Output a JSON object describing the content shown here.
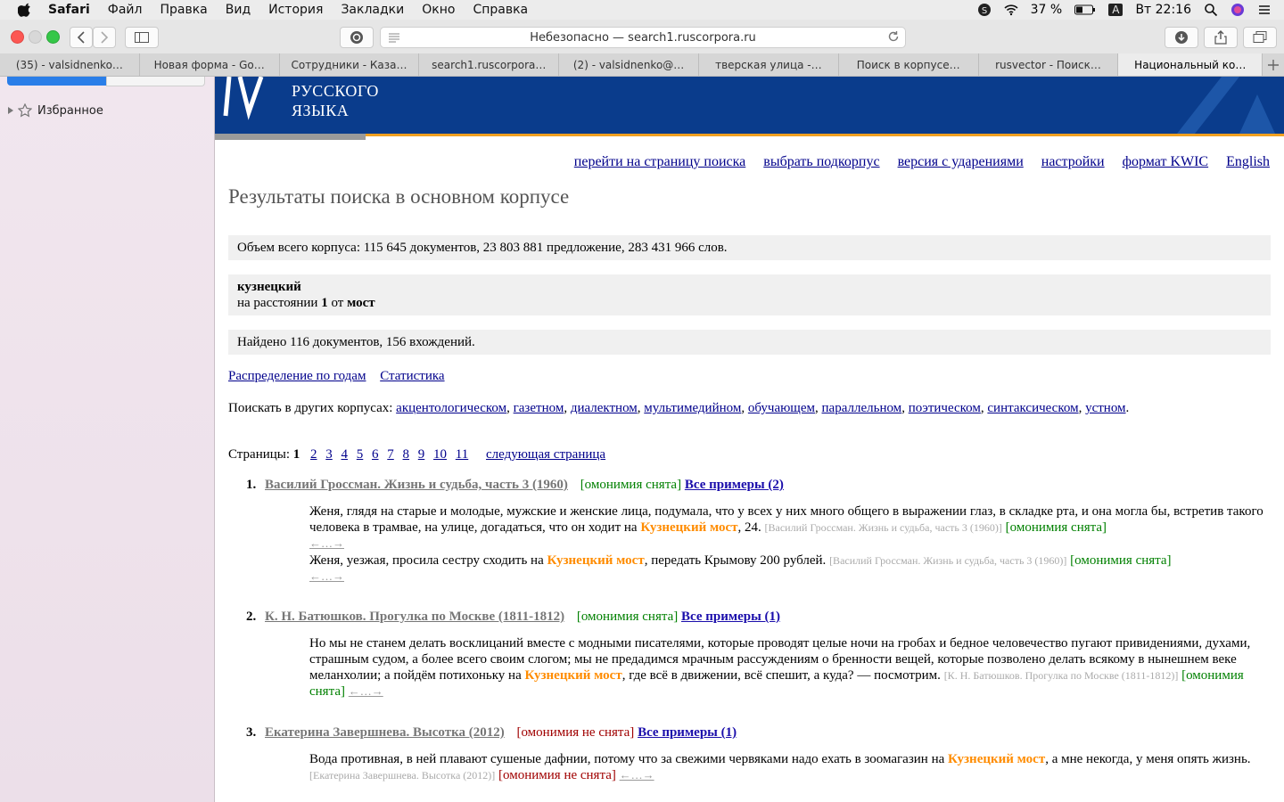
{
  "menubar": {
    "app": "Safari",
    "items": [
      "Файл",
      "Правка",
      "Вид",
      "История",
      "Закладки",
      "Окно",
      "Справка"
    ],
    "battery": "37 %",
    "input_lang": "A",
    "clock": "Вт 22:16"
  },
  "toolbar": {
    "address": "Небезопасно — search1.ruscorpora.ru"
  },
  "tabs": [
    "(35) - valsidnenko…",
    "Новая форма - Go…",
    "Сотрудники - Каза…",
    "search1.ruscorpora…",
    "(2) - valsidnenko@…",
    "тверская улица -…",
    "Поиск в корпусе…",
    "rusvector - Поиск…",
    "Национальный ко…"
  ],
  "sidebar": {
    "favorites_label": "Избранное"
  },
  "banner": {
    "line1": "РУССКОГО",
    "line2": "ЯЗЫКА"
  },
  "toplinks": [
    "перейти на страницу поиска",
    "выбрать подкорпус",
    "версия с ударениями",
    "настройки",
    "формат KWIC",
    "English"
  ],
  "page_title": "Результаты поиска в основном корпусе",
  "corpus_volume": "Объем всего корпуса: 115 645 документов, 23 803 881 предложение, 283 431 966 слов.",
  "query": {
    "word1": "кузнецкий",
    "dist_prefix": "на расстоянии",
    "dist_value": "1",
    "dist_mid": "от",
    "word2": "мост"
  },
  "found": "Найдено 116 документов, 156 вхождений.",
  "stat_links": [
    "Распределение по годам",
    "Статистика"
  ],
  "other_corpora": {
    "prefix": "Поискать в других корпусах:",
    "items": [
      "акцентологическом",
      "газетном",
      "диалектном",
      "мультимедийном",
      "обучающем",
      "параллельном",
      "поэтическом",
      "синтаксическом",
      "устном"
    ]
  },
  "pages": {
    "label": "Страницы:",
    "current": "1",
    "items": [
      "2",
      "3",
      "4",
      "5",
      "6",
      "7",
      "8",
      "9",
      "10",
      "11"
    ],
    "next": "следующая страница"
  },
  "results": [
    {
      "num": "1.",
      "doc": "Василий Гроссман. Жизнь и судьба, часть 3 (1960)",
      "homonymy": "[омонимия снята]",
      "all": "Все примеры (2)",
      "snippets": [
        {
          "pre": "Женя, глядя на старые и молодые, мужские и женские лица, подумала, что у всех у них много общего в выражении глаз, в складке рта, и она могла бы, встретив такого человека в трамвае, на улице, догадаться, что он ходит на ",
          "hit": "Кузнецкий мост",
          "post": ", 24. ",
          "src": "[Василий Гроссман. Жизнь и судьба, часть 3 (1960)]",
          "hom": "[омонимия снята]",
          "arrow": "←…→"
        },
        {
          "pre": "Женя, уезжая, просила сестру сходить на ",
          "hit": "Кузнецкий мост",
          "post": ", передать Крымову 200 рублей. ",
          "src": "[Василий Гроссман. Жизнь и судьба, часть 3 (1960)]",
          "hom": "[омонимия снята]",
          "arrow": "←…→"
        }
      ]
    },
    {
      "num": "2.",
      "doc": "К. Н. Батюшков. Прогулка по Москве (1811-1812)",
      "homonymy": "[омонимия снята]",
      "all": "Все примеры (1)",
      "snippets": [
        {
          "pre": "Но мы не станем делать восклицаний вместе с модными писателями, которые проводят целые ночи на гробах и бедное человечество пугают привидениями, духами, страшным судом, а более всего своим слогом; мы не предадимся мрачным рассуждениям о бренности вещей, которые позволено делать всякому в нынешнем веке меланхолии; а пойдём потихоньку на ",
          "hit": "Кузнецкий мост",
          "post": ", где всё в движении, всё спешит, а куда? — посмотрим. ",
          "src": "[К. Н. Батюшков. Прогулка по Москве (1811-1812)]",
          "hom": "[омонимия снята]",
          "arrow": "←…→"
        }
      ]
    },
    {
      "num": "3.",
      "doc": "Екатерина Завершнева. Высотка (2012)",
      "homonymy": "[омонимия не снята]",
      "all": "Все примеры (1)",
      "snippets": [
        {
          "pre": "Вода противная, в ней плавают сушеные дафнии, потому что за свежими червяками надо ехать в зоомагазин на ",
          "hit": "Кузнецкий мост",
          "post": ", а мне некогда, у меня опять жизнь. ",
          "src": "[Екатерина Завершнева. Высотка (2012)]",
          "hom": "[омонимия не снята]",
          "arrow": "←…→"
        }
      ]
    }
  ]
}
